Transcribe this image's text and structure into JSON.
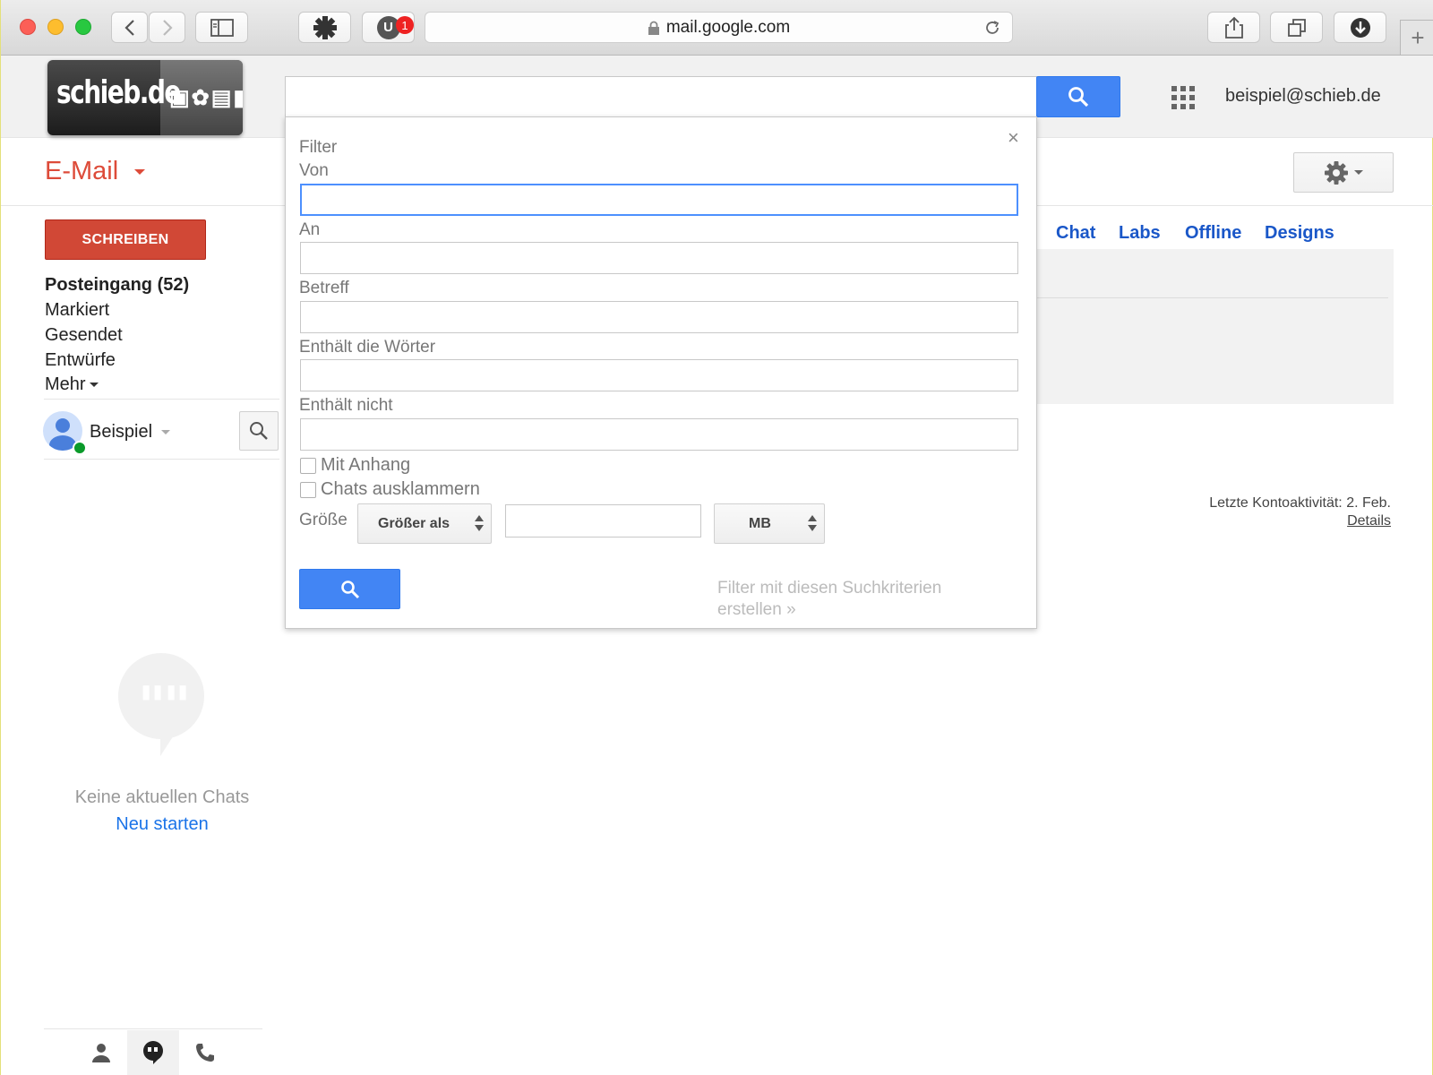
{
  "browser": {
    "url": "mail.google.com",
    "extension_badge_letter": "U",
    "extension_badge_count": "1"
  },
  "header": {
    "logo_text": "schieb.de",
    "user_email": "beispiel@schieb.de"
  },
  "app": {
    "title": "E-Mail",
    "compose_label": "SCHREIBEN"
  },
  "nav": {
    "items": [
      {
        "label": "Posteingang (52)",
        "bold": true
      },
      {
        "label": "Markiert",
        "bold": false
      },
      {
        "label": "Gesendet",
        "bold": false
      },
      {
        "label": "Entwürfe",
        "bold": false
      },
      {
        "label": "Mehr",
        "bold": false
      }
    ]
  },
  "chat": {
    "user_name": "Beispiel",
    "empty_text": "Keine aktuellen Chats",
    "start_link": "Neu starten"
  },
  "settings_tabs": [
    "Chat",
    "Labs",
    "Offline",
    "Designs"
  ],
  "footer": {
    "last_activity": "Letzte Kontoaktivität: 2. Feb.",
    "details_link": "Details"
  },
  "filter": {
    "title": "Filter",
    "from_label": "Von",
    "to_label": "An",
    "subject_label": "Betreff",
    "has_words_label": "Enthält die Wörter",
    "not_words_label": "Enthält nicht",
    "has_attachment_label": "Mit Anhang",
    "exclude_chats_label": "Chats ausklammern",
    "size_label": "Größe",
    "size_operator": "Größer als",
    "size_unit": "MB",
    "create_filter_link": "Filter mit diesen Suchkriterien erstellen »",
    "close_symbol": "×"
  },
  "colors": {
    "accent_blue": "#4285f4",
    "compose_red": "#d14836",
    "title_red": "#dd4b39",
    "link_blue": "#1a57c8"
  }
}
